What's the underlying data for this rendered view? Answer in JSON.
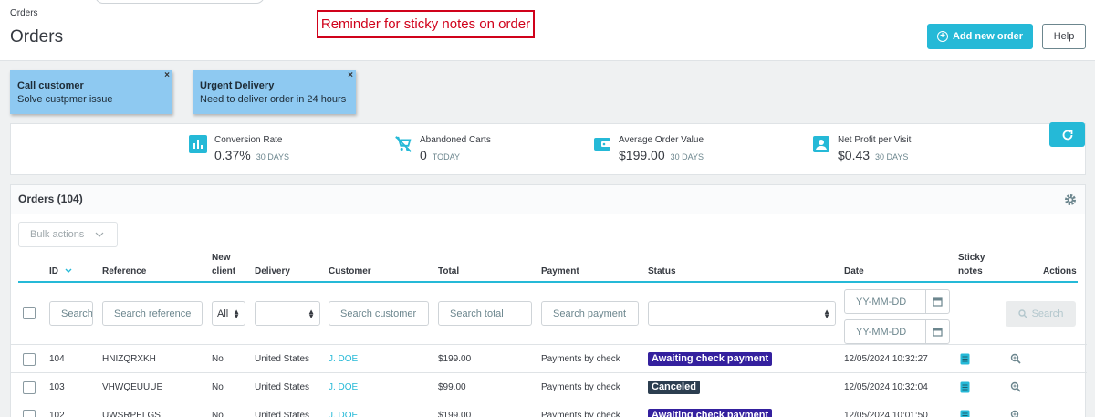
{
  "header": {
    "breadcrumb": "Orders",
    "title": "Orders",
    "reminder_annotation": "Reminder for sticky notes on order",
    "add_button": "Add new order",
    "help_button": "Help"
  },
  "sticky_notes": [
    {
      "title": "Call customer",
      "body": "Solve custpmer issue",
      "close": "×"
    },
    {
      "title": "Urgent Delivery",
      "body": "Need to deliver order in 24 hours",
      "close": "×"
    }
  ],
  "kpis": [
    {
      "label": "Conversion Rate",
      "value": "0.37%",
      "period": "30 DAYS",
      "icon": "bar-chart-icon"
    },
    {
      "label": "Abandoned Carts",
      "value": "0",
      "period": "TODAY",
      "icon": "cart-off-icon"
    },
    {
      "label": "Average Order Value",
      "value": "$199.00",
      "period": "30 DAYS",
      "icon": "wallet-icon"
    },
    {
      "label": "Net Profit per Visit",
      "value": "$0.43",
      "period": "30 DAYS",
      "icon": "profile-card-icon"
    }
  ],
  "orders": {
    "title": "Orders (104)",
    "bulk_actions": "Bulk actions",
    "columns": {
      "id": "ID",
      "reference": "Reference",
      "new_client_1": "New",
      "new_client_2": "client",
      "delivery": "Delivery",
      "customer": "Customer",
      "total": "Total",
      "payment": "Payment",
      "status": "Status",
      "date": "Date",
      "sticky_1": "Sticky",
      "sticky_2": "notes",
      "actions": "Actions"
    },
    "filters": {
      "id_placeholder": "Search ID",
      "reference_placeholder": "Search reference",
      "new_client_value": "All",
      "customer_placeholder": "Search customer",
      "total_placeholder": "Search total",
      "payment_placeholder": "Search payment",
      "date_from_placeholder": "YY-MM-DD",
      "date_to_placeholder": "YY-MM-DD",
      "search_button": "Search"
    },
    "rows": [
      {
        "id": "104",
        "reference": "HNIZQRXKH",
        "new_client": "No",
        "delivery": "United States",
        "customer": "J. DOE",
        "total": "$199.00",
        "payment": "Payments by check",
        "status": "Awaiting check payment",
        "status_color": "#34209e",
        "date": "12/05/2024 10:32:27"
      },
      {
        "id": "103",
        "reference": "VHWQEUUUE",
        "new_client": "No",
        "delivery": "United States",
        "customer": "J. DOE",
        "total": "$99.00",
        "payment": "Payments by check",
        "status": "Canceled",
        "status_color": "#2c3e50",
        "date": "12/05/2024 10:32:04"
      },
      {
        "id": "102",
        "reference": "UWSRPELGS",
        "new_client": "No",
        "delivery": "United States",
        "customer": "J. DOE",
        "total": "$199.00",
        "payment": "Payments by check",
        "status": "Awaiting check payment",
        "status_color": "#34209e",
        "date": "12/05/2024 10:01:50"
      }
    ]
  },
  "colors": {
    "accent": "#25b9d7",
    "note": "#8ec9f1",
    "annotation": "#d0021b"
  }
}
